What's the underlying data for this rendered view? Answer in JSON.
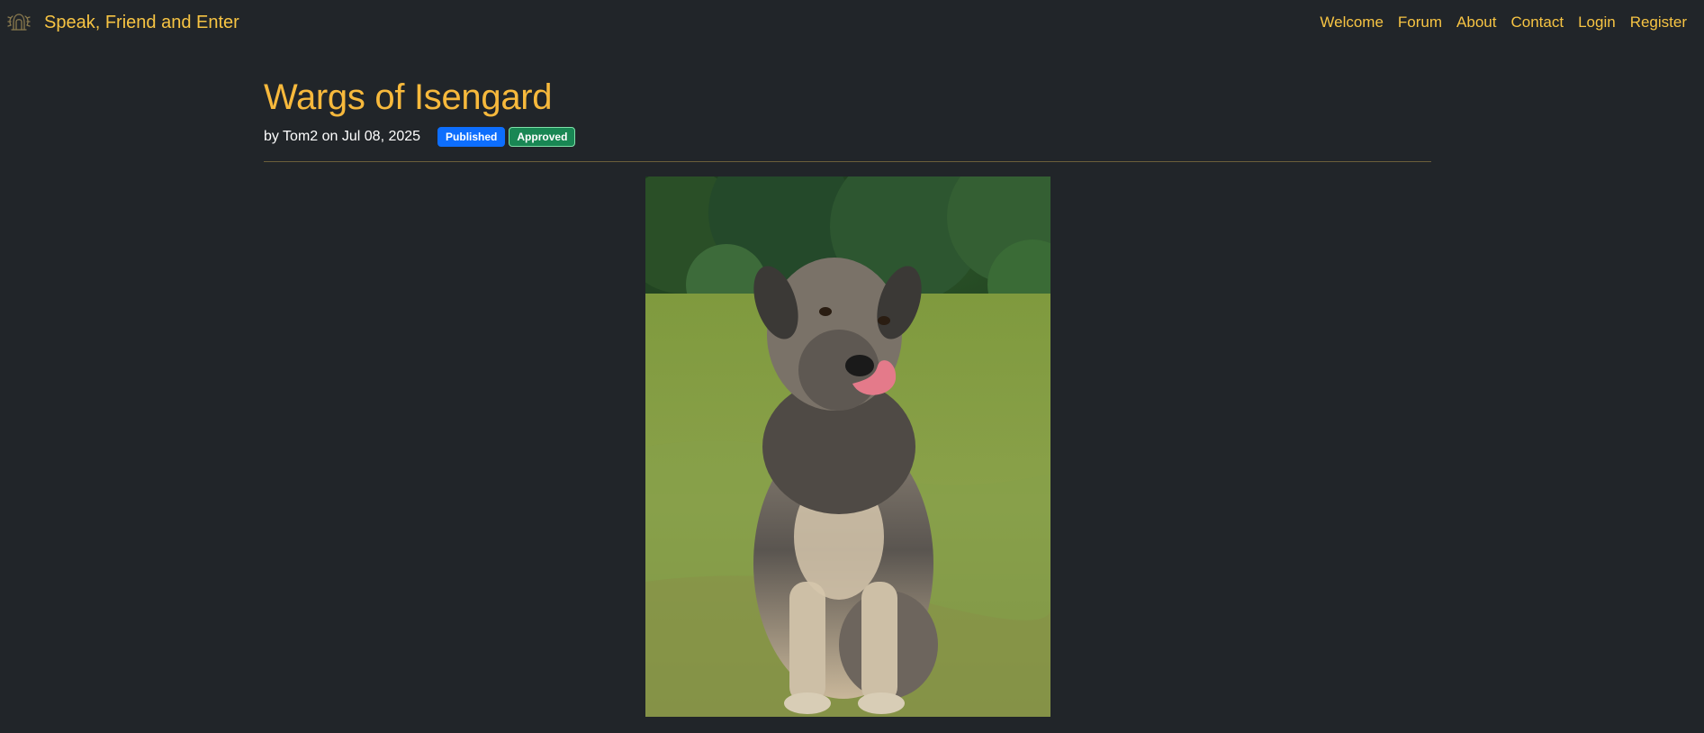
{
  "navbar": {
    "brand_logo_icon": "ornamental-emblem-icon",
    "brand_text": "Speak, Friend and Enter",
    "links": [
      {
        "label": "Welcome"
      },
      {
        "label": "Forum"
      },
      {
        "label": "About"
      },
      {
        "label": "Contact"
      },
      {
        "label": "Login"
      },
      {
        "label": "Register"
      }
    ]
  },
  "post": {
    "title": "Wargs of Isengard",
    "byline": "by Tom2 on Jul 08, 2025",
    "badges": {
      "published": "Published",
      "approved": "Approved"
    },
    "image_alt": "dog-photo"
  },
  "colors": {
    "background": "#212529",
    "accent": "#f7c443",
    "title": "#f7b93c",
    "published_badge": "#0d6efd",
    "approved_badge": "#198754"
  }
}
